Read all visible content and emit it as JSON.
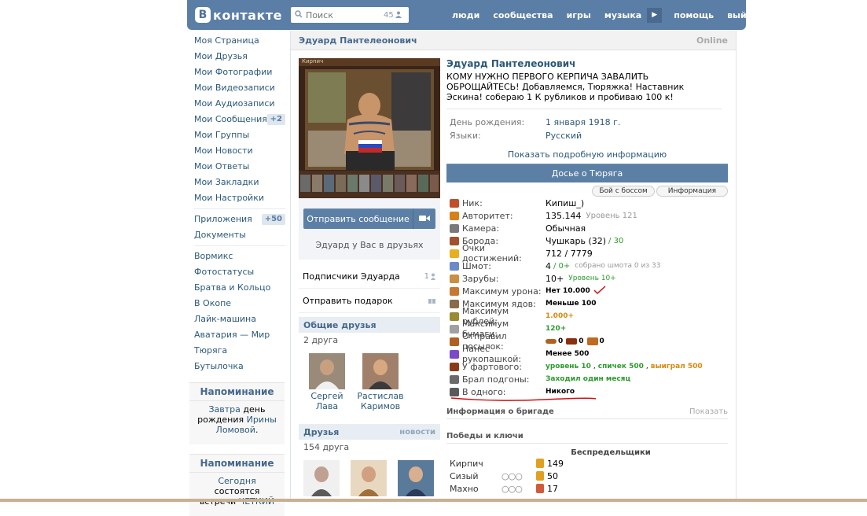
{
  "header": {
    "logo_letter": "В",
    "logo_text": "контакте",
    "search_placeholder": "Поиск",
    "search_count": "45",
    "nav": [
      "люди",
      "сообщества",
      "игры",
      "музыка",
      "помощь",
      "выйти"
    ]
  },
  "sidebar": {
    "items": [
      {
        "label": "Моя Страница"
      },
      {
        "label": "Мои Друзья"
      },
      {
        "label": "Мои Фотографии"
      },
      {
        "label": "Мои Видеозаписи"
      },
      {
        "label": "Мои Аудиозаписи"
      },
      {
        "label": "Мои Сообщения",
        "badge": "+2"
      },
      {
        "label": "Мои Группы"
      },
      {
        "label": "Мои Новости"
      },
      {
        "label": "Мои Ответы"
      },
      {
        "label": "Мои Закладки"
      },
      {
        "label": "Мои Настройки"
      }
    ],
    "items2": [
      {
        "label": "Приложения",
        "badge": "+50"
      },
      {
        "label": "Документы"
      }
    ],
    "apps": [
      "Вормикс",
      "Фотостатусы",
      "Братва и Кольцо",
      "В Окопе",
      "Лайк-машина",
      "Аватария — Мир",
      "Тюряга",
      "Бутылочка"
    ],
    "reminder1": {
      "title": "Напоминание",
      "t1": "Завтра",
      "t2": "день рождения",
      "t3": "Ирины Ломовой",
      "t4": "."
    },
    "reminder2": {
      "title": "Напоминание",
      "t1": "Сегодня",
      "t2": "состоятся встречи",
      "t3": "ЧЕТКИЙ"
    }
  },
  "profile": {
    "header_name": "Эдуард Пантелеонович",
    "online": "Online",
    "avatar_caption": "Кирпич",
    "send_message": "Отправить сообщение",
    "in_friends": "Эдуард у Вас в друзьях",
    "subscribers": "Подписчики Эдуарда",
    "subscribers_count": "1",
    "send_gift": "Отправить подарок",
    "common_friends_title": "Общие друзья",
    "common_friends_count": "2 друга",
    "common_friends": [
      {
        "first": "Сергей",
        "last": "Лава"
      },
      {
        "first": "Растислав",
        "last": "Каримов"
      }
    ],
    "friends_title": "Друзья",
    "friends_link": "новости",
    "friends_count": "154 друга",
    "name": "Эдуард Пантелеонович",
    "status": "КОМУ НУЖНО ПЕРВОГО КЕРПИЧА ЗАВАЛИТЬ ОБРОЩАЙТЕСЬ! Добавляемся, Тюряжка! Наставник Эскина! собераю 1 К рубликов и пробиваю 100 к!",
    "birthday_label": "День рождения:",
    "birthday_value": "1 января 1918 г.",
    "languages_label": "Языки:",
    "languages_value": "Русский",
    "show_details": "Показать подробную информацию",
    "dossier": "Досье о Тюряга",
    "tab_boss": "Бой с боссом",
    "tab_info": "Информация"
  },
  "stats": [
    {
      "label": "Ник:",
      "value": "Кипиш_)",
      "extra": "",
      "icon_color": "#c0502a"
    },
    {
      "label": "Авторитет:",
      "value": "135.144",
      "extra": "Уровень 121",
      "icon_color": "#d8801a"
    },
    {
      "label": "Камера:",
      "value": "Обычная",
      "extra": "",
      "icon_color": "#7a7a7a"
    },
    {
      "label": "Борода:",
      "value": "Чушкарь (32)",
      "extra": "/ 30",
      "icon_color": "#a0522d"
    },
    {
      "label": "Очки достижений:",
      "value": "712 / 7779",
      "extra": "",
      "icon_color": "#e8b020"
    },
    {
      "label": "Шмот:",
      "value": "4",
      "extra": "/ 0+",
      "extra2": "собрано шмота 0 из 33",
      "icon_color": "#6a8ac8"
    },
    {
      "label": "Зарубы:",
      "value": "10+",
      "extra": "Уровень 10+",
      "icon_color": "#c89040"
    },
    {
      "label": "Максимум урона:",
      "value": "Нет 10.000",
      "extra": "",
      "icon_color": "#c87830"
    },
    {
      "label": "Максимум ядов:",
      "value": "Меньше 100",
      "extra": "",
      "icon_color": "#8a6a4a"
    },
    {
      "label": "Максимум рублей:",
      "value": "1.000+",
      "extra": "",
      "icon_color": "#9a8a30"
    },
    {
      "label": "Максимум бумаги:",
      "value": "120+",
      "extra": "",
      "icon_color": "#a0a0a0"
    },
    {
      "label": "Отправил посылок:",
      "value": "0",
      "v2": "0",
      "v3": "0",
      "extra": "",
      "icon_color": "#b06020"
    },
    {
      "label": "Нанес рукопашкой:",
      "value": "Менее 500",
      "extra": "",
      "icon_color": "#7a4ac8"
    },
    {
      "label": "У фартового:",
      "value": "уровень 10",
      "v2": "спичек 500",
      "v3": "выиграл 500",
      "extra": "",
      "icon_color": "#8a3a1a"
    },
    {
      "label": "Брал подгоны:",
      "value": "Заходил один месяц",
      "extra": "",
      "icon_color": "#6a6a6a"
    },
    {
      "label": "В одного:",
      "value": "Никого",
      "extra": "",
      "icon_color": "#5a5a5a"
    }
  ],
  "brigade": {
    "title": "Информация о бригаде",
    "link": "Показать"
  },
  "wins": {
    "title": "Победы и ключи",
    "column": "Беспредельщики",
    "rows": [
      {
        "name": "Кирпич",
        "value": "149",
        "circles": false
      },
      {
        "name": "Сизый",
        "value": "50",
        "circles": true
      },
      {
        "name": "Махно",
        "value": "17",
        "circles": true
      }
    ]
  }
}
